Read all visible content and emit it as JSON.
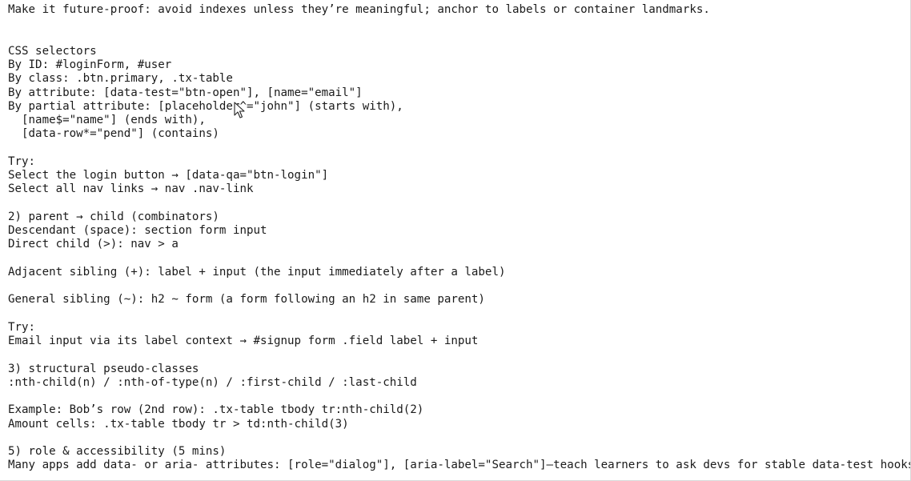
{
  "document": {
    "lines": [
      "Make it future-proof: avoid indexes unless they’re meaningful; anchor to labels or container landmarks.",
      "",
      "",
      "CSS selectors",
      "By ID: #loginForm, #user",
      "By class: .btn.primary, .tx-table",
      "By attribute: [data-test=\"btn-open\"], [name=\"email\"]",
      "By partial attribute: [placeholder^=\"john\"] (starts with),",
      "  [name$=\"name\"] (ends with),",
      "  [data-row*=\"pend\"] (contains)",
      "",
      "Try:",
      "Select the login button → [data-qa=\"btn-login\"]",
      "Select all nav links → nav .nav-link",
      "",
      "2) parent → child (combinators)",
      "Descendant (space): section form input",
      "Direct child (>): nav > a",
      "",
      "Adjacent sibling (+): label + input (the input immediately after a label)",
      "",
      "General sibling (~): h2 ~ form (a form following an h2 in same parent)",
      "",
      "Try:",
      "Email input via its label context → #signup form .field label + input",
      "",
      "3) structural pseudo-classes",
      ":nth-child(n) / :nth-of-type(n) / :first-child / :last-child",
      "",
      "Example: Bob’s row (2nd row): .tx-table tbody tr:nth-child(2)",
      "Amount cells: .tx-table tbody tr > td:nth-child(3)",
      "",
      "5) role & accessibility (5 mins)",
      "Many apps add data- or aria- attributes: [role=\"dialog\"], [aria-label=\"Search\"]—teach learners to ask devs for stable data-test hooks."
    ]
  },
  "cursor": {
    "icon": "mouse-pointer-icon"
  }
}
